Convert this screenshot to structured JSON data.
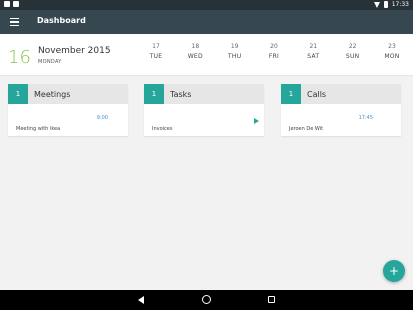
{
  "status_bar": {
    "time": "17:33"
  },
  "app_bar": {
    "title": "Dashboard"
  },
  "calendar": {
    "big_day": "16",
    "month_year": "November 2015",
    "weekday": "MONDAY",
    "week": [
      {
        "num": "17",
        "name": "TUE"
      },
      {
        "num": "18",
        "name": "WED"
      },
      {
        "num": "19",
        "name": "THU"
      },
      {
        "num": "20",
        "name": "FRI"
      },
      {
        "num": "21",
        "name": "SAT"
      },
      {
        "num": "22",
        "name": "SUN"
      },
      {
        "num": "23",
        "name": "MON"
      }
    ]
  },
  "cards": {
    "meetings": {
      "count": "1",
      "title": "Meetings",
      "item": "Meeting with ikea",
      "time": "9:00"
    },
    "tasks": {
      "count": "1",
      "title": "Tasks",
      "item": "Invoices"
    },
    "calls": {
      "count": "1",
      "title": "Calls",
      "item": "Jeroen De Wit",
      "time": "17:45"
    }
  },
  "fab": {
    "label": "+"
  },
  "colors": {
    "accent": "#26a69a",
    "appbar": "#37474f",
    "today": "#8bc34a",
    "time_text": "#4a90c8"
  }
}
